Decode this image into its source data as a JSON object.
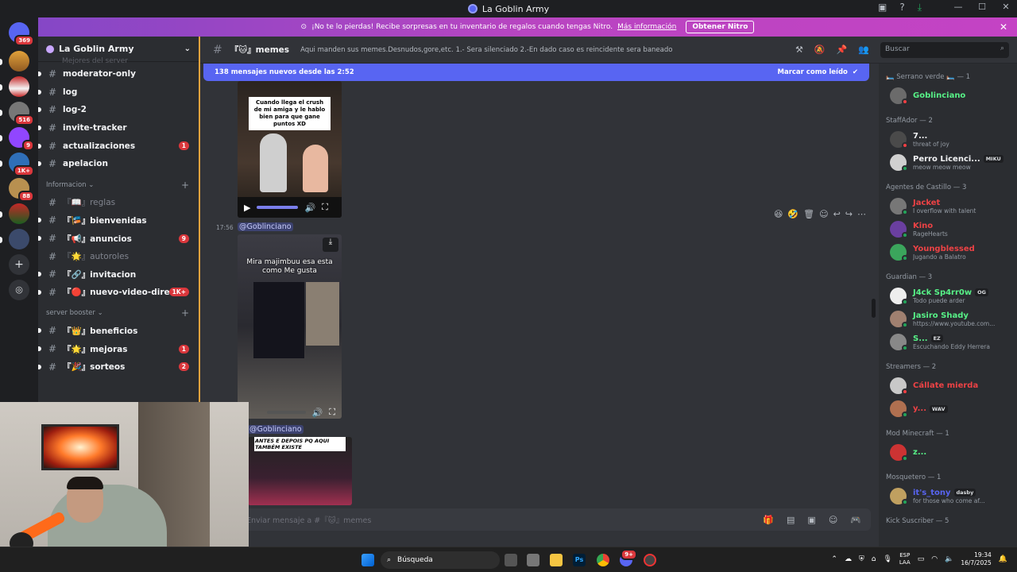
{
  "window": {
    "title": "La Goblin Army"
  },
  "nitro": {
    "text": "¡No te lo pierdas! Recibe sorpresas en tu inventario de regalos cuando tengas Nitro.",
    "link": "Más información",
    "button": "Obtener Nitro",
    "color_start": "#8547c6",
    "color_end": "#c443c4"
  },
  "servers": {
    "home_badge": "369",
    "badges": [
      "516",
      "9",
      "1K+",
      "88"
    ]
  },
  "guild": {
    "name": "La Goblin Army",
    "faded_text": "Mejores del server"
  },
  "channels_top": [
    {
      "label": "moderator-only",
      "unread": true,
      "count": ""
    },
    {
      "label": "log",
      "unread": true,
      "count": ""
    },
    {
      "label": "log-2",
      "unread": true,
      "count": ""
    },
    {
      "label": "invite-tracker",
      "unread": true,
      "count": ""
    },
    {
      "label": "actualizaciones",
      "unread": true,
      "count": "1"
    },
    {
      "label": "apelacion",
      "unread": true,
      "count": ""
    }
  ],
  "category_info": {
    "label": "Informacion"
  },
  "channels_info": [
    {
      "label": "『📖』reglas",
      "muted": true,
      "count": ""
    },
    {
      "label": "『🎏』bienvenidas",
      "muted": false,
      "count": ""
    },
    {
      "label": "『📢』anuncios",
      "muted": false,
      "count": "9"
    },
    {
      "label": "『🌟』autoroles",
      "muted": true,
      "count": ""
    },
    {
      "label": "『🔗』invitacion",
      "muted": false,
      "count": ""
    },
    {
      "label": "『🔴』nuevo-video-direc...",
      "muted": false,
      "count": "1K+"
    }
  ],
  "category_booster": {
    "label": "server booster"
  },
  "channels_booster": [
    {
      "label": "『👑』beneficios",
      "count": ""
    },
    {
      "label": "『🌟』mejoras",
      "count": "1"
    },
    {
      "label": "『🎉』sorteos",
      "count": "2"
    }
  ],
  "header": {
    "channel_name": "『🐱』memes",
    "topic": "Aqui manden sus memes.Desnudos,gore,etc. 1.- Sera silenciado 2.-En dado caso es reincidente sera baneado",
    "search_placeholder": "Buscar"
  },
  "new_messages": {
    "text": "138 mensajes nuevos desde las 2:52",
    "mark_read": "Marcar como leído",
    "color": "#5865f2"
  },
  "messages": {
    "video1_caption": "Cuando llega el crush de mi amiga y le hablo bien para que gane puntos XD",
    "timestamp": "17:56",
    "mention1": "@Goblinciano",
    "video2_caption": "Mira majimbuu esa esta como Me gusta",
    "mention2": "@Goblinciano",
    "video3_caption": "ANTES E DEPOIS PQ AQUI TAMBÉM EXISTE"
  },
  "composer": {
    "placeholder": "Enviar mensaje a #『🐱』memes"
  },
  "members": [
    {
      "group": "🛏️ Serrano verde 🛏️ — 1",
      "items": [
        {
          "name": "Goblinciano",
          "sub": "",
          "tag": "",
          "color": "#57f287",
          "status": "dnd",
          "av": "#6b6b6b"
        }
      ]
    },
    {
      "group": "StaffAdor — 2",
      "items": [
        {
          "name": "7...",
          "sub": "threat of joy",
          "tag": "",
          "color": "#f2f3f5",
          "status": "dnd",
          "av": "#4a4a4a"
        },
        {
          "name": "Perro Licenci...",
          "sub": "meow meow meow",
          "tag": "MIKU",
          "color": "#f2f3f5",
          "status": "online",
          "av": "#d0d0d0"
        }
      ]
    },
    {
      "group": "Agentes de Castillo — 3",
      "items": [
        {
          "name": "Jacket",
          "sub": "I overflow with talent",
          "tag": "",
          "color": "#ed4245",
          "status": "online",
          "av": "#777"
        },
        {
          "name": "Kino",
          "sub": "RageHearts",
          "tag": "",
          "color": "#ed4245",
          "status": "online",
          "av": "#6a3fa0"
        },
        {
          "name": "Youngblessed",
          "sub": "Jugando a Balatro",
          "tag": "",
          "color": "#ed4245",
          "status": "online",
          "av": "#3ba55c"
        }
      ]
    },
    {
      "group": "Guardian — 3",
      "items": [
        {
          "name": "J4ck Sp4rr0w",
          "sub": "Todo puede arder",
          "tag": "OG",
          "color": "#57f287",
          "status": "online",
          "av": "#eeeeee"
        },
        {
          "name": "Jasiro Shady",
          "sub": "https://www.youtube.com...",
          "tag": "",
          "color": "#57f287",
          "status": "online",
          "av": "#a08070"
        },
        {
          "name": "S...",
          "sub": "Escuchando Eddy Herrera",
          "tag": "EZ",
          "color": "#57f287",
          "status": "online",
          "av": "#888"
        }
      ]
    },
    {
      "group": "Streamers — 2",
      "items": [
        {
          "name": "Cállate mierda",
          "sub": "",
          "tag": "",
          "color": "#ed4245",
          "status": "dnd",
          "av": "#c8c8c8"
        },
        {
          "name": "y...",
          "sub": "",
          "tag": "WAV",
          "color": "#ed4245",
          "status": "online",
          "av": "#b07050"
        }
      ]
    },
    {
      "group": "Mod Minecraft — 1",
      "items": [
        {
          "name": "z...",
          "sub": "",
          "tag": "",
          "color": "#57f287",
          "status": "online",
          "av": "#cc3333"
        }
      ]
    },
    {
      "group": "Mosquetero — 1",
      "items": [
        {
          "name": "it's_tony",
          "sub": "for those who come af...",
          "tag": "dasby",
          "color": "#5865f2",
          "status": "online",
          "av": "#c0a060"
        }
      ]
    },
    {
      "group": "Kick Suscriber — 5",
      "items": []
    }
  ],
  "taskbar": {
    "search": "Búsqueda",
    "lang_top": "ESP",
    "lang_bottom": "LAA",
    "time": "19:34",
    "date": "16/7/2025",
    "discord_badge": "9+"
  }
}
